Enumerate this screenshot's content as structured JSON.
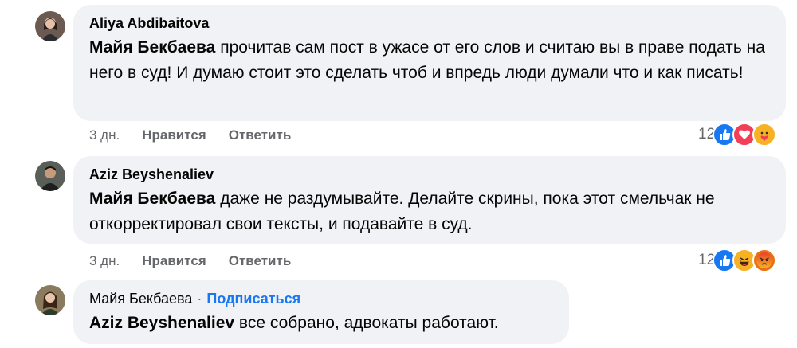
{
  "comments": [
    {
      "author": "Aliya Abdibaitova",
      "mention": "Майя Бекбаева",
      "body": " прочитав сам пост в ужасе от его слов и считаю вы в праве подать на него в суд! И думаю стоит это сделать чтоб и впредь люди думали что и как писать!",
      "time": "3 дн.",
      "like_label": "Нравится",
      "reply_label": "Ответить",
      "reaction_count": "12",
      "reactions": [
        "like",
        "love",
        "care"
      ]
    },
    {
      "author": "Aziz Beyshenaliev",
      "mention": "Майя Бекбаева",
      "body": " даже не раздумывайте. Делайте скрины, пока этот смельчак не откорректировал свои тексты, и подавайте в суд.",
      "time": "3 дн.",
      "like_label": "Нравится",
      "reply_label": "Ответить",
      "reaction_count": "12",
      "reactions": [
        "like",
        "haha",
        "angry"
      ]
    },
    {
      "author": "Майя Бекбаева",
      "separator": "·",
      "follow_label": "Подписаться",
      "mention": "Aziz Beyshenaliev",
      "body": " все собрано, адвокаты работают."
    }
  ],
  "colors": {
    "bubble": "#f0f2f5",
    "link_blue": "#1877f2",
    "meta_gray": "#65676b"
  }
}
